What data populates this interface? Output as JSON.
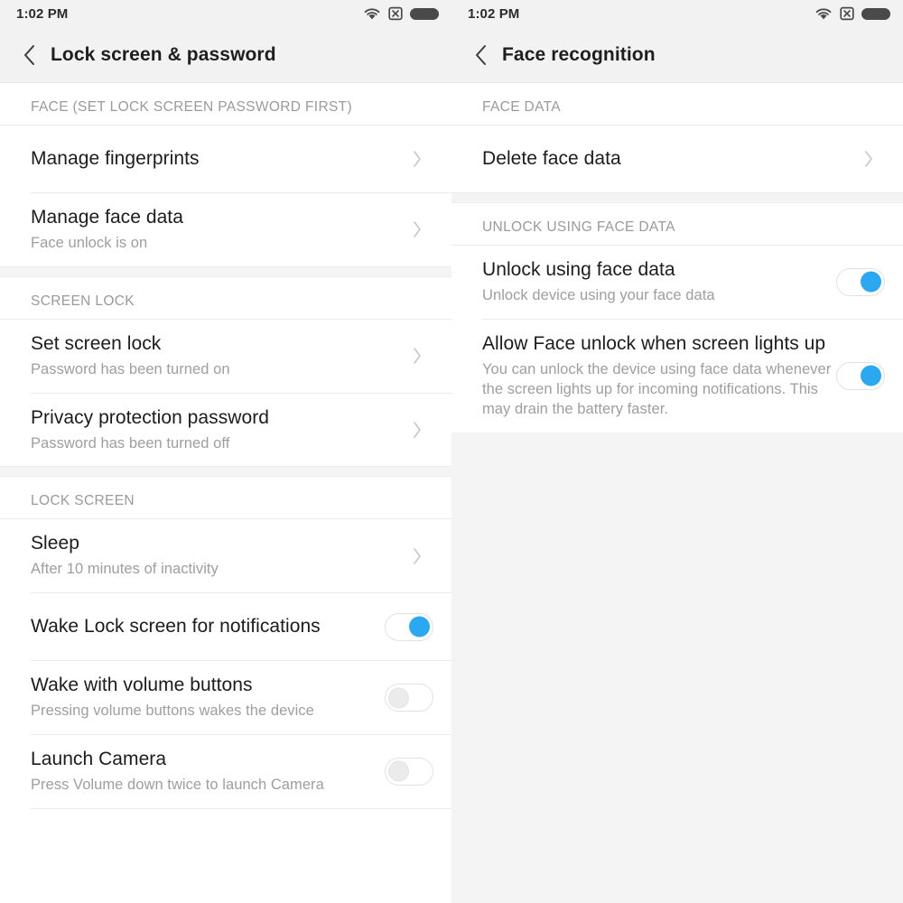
{
  "theme": {
    "accent": "#2ca8f0",
    "header_bg": "#f2f2f2",
    "content_bg": "#ffffff",
    "page_bg": "#f4f4f4",
    "title_color": "#1c1c1c",
    "subtitle_color": "#9e9e9e",
    "section_color": "#9a9a9a"
  },
  "left": {
    "status": {
      "time": "1:02 PM",
      "icons": [
        "wifi-icon",
        "sim-missing-icon",
        "battery-icon"
      ]
    },
    "header": {
      "back": "back-icon",
      "title": "Lock screen & password"
    },
    "sections": [
      {
        "header": "FACE (SET LOCK SCREEN PASSWORD FIRST)",
        "rows": [
          {
            "title": "Manage fingerprints",
            "sub": "",
            "accessory": "chevron"
          },
          {
            "title": "Manage face data",
            "sub": "Face unlock is on",
            "accessory": "chevron"
          }
        ]
      },
      {
        "header": "SCREEN LOCK",
        "rows": [
          {
            "title": "Set screen lock",
            "sub": "Password has been turned on",
            "accessory": "chevron"
          },
          {
            "title": "Privacy protection password",
            "sub": "Password has been turned off",
            "accessory": "chevron"
          }
        ]
      },
      {
        "header": "LOCK SCREEN",
        "rows": [
          {
            "title": "Sleep",
            "sub": "After 10 minutes of inactivity",
            "accessory": "chevron"
          },
          {
            "title": "Wake Lock screen for notifications",
            "sub": "",
            "accessory": "toggle",
            "toggle": "on"
          },
          {
            "title": "Wake with volume buttons",
            "sub": "Pressing volume buttons wakes the device",
            "accessory": "toggle",
            "toggle": "off"
          },
          {
            "title": "Launch Camera",
            "sub": "Press Volume down twice to launch Camera",
            "accessory": "toggle",
            "toggle": "off"
          }
        ]
      }
    ]
  },
  "right": {
    "status": {
      "time": "1:02 PM",
      "icons": [
        "wifi-icon",
        "sim-missing-icon",
        "battery-icon"
      ]
    },
    "header": {
      "back": "back-icon",
      "title": "Face recognition"
    },
    "sections": [
      {
        "header": "FACE DATA",
        "rows": [
          {
            "title": "Delete face data",
            "sub": "",
            "accessory": "chevron"
          }
        ]
      },
      {
        "header": "UNLOCK USING FACE DATA",
        "rows": [
          {
            "title": "Unlock using face data",
            "sub": "Unlock device using your face data",
            "accessory": "toggle",
            "toggle": "on"
          },
          {
            "title": "Allow Face unlock when screen lights up",
            "sub": "You can unlock the device using face data whenever the screen lights up for incoming notifications. This may drain the battery faster.",
            "accessory": "toggle",
            "toggle": "on"
          }
        ]
      }
    ]
  }
}
